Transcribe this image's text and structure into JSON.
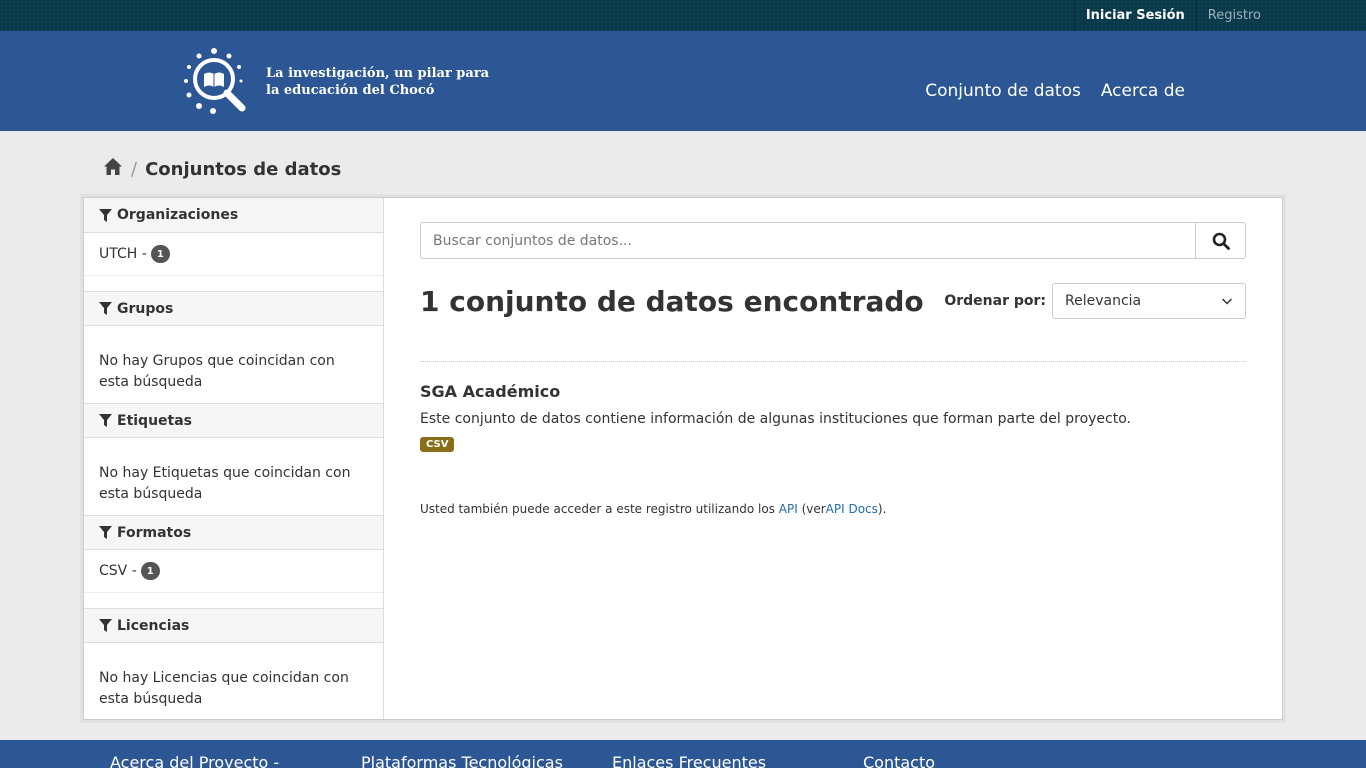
{
  "account": {
    "login": "Iniciar Sesión",
    "register": "Registro"
  },
  "masthead": {
    "logo_line1": "La investigación, un pilar para",
    "logo_line2": "la educación del Chocó",
    "nav": [
      "Conjunto de datos",
      "Acerca de"
    ]
  },
  "breadcrumb": {
    "current": "Conjuntos de datos"
  },
  "facets": {
    "organizations": {
      "title": "Organizaciones",
      "item": "UTCH -",
      "count": "1"
    },
    "groups": {
      "title": "Grupos",
      "empty": "No hay Grupos que coincidan con esta búsqueda"
    },
    "tags": {
      "title": "Etiquetas",
      "empty": "No hay Etiquetas que coincidan con esta búsqueda"
    },
    "formats": {
      "title": "Formatos",
      "item": "CSV -",
      "count": "1"
    },
    "licenses": {
      "title": "Licencias",
      "empty": "No hay Licencias que coincidan con esta búsqueda"
    }
  },
  "search": {
    "placeholder": "Buscar conjuntos de datos..."
  },
  "results": {
    "count_text": "1 conjunto de datos encontrado",
    "sort_label": "Ordenar por:",
    "sort_value": "Relevancia"
  },
  "dataset": {
    "title": "SGA Académico",
    "notes": "Este conjunto de datos contiene información de algunas instituciones que forman parte del proyecto.",
    "format": "CSV"
  },
  "api_note": {
    "prefix": "Usted también puede acceder a este registro utilizando los",
    "api": "API",
    "middle": "(ver",
    "docs": "API Docs",
    "suffix": ")."
  },
  "footer": {
    "columns": [
      "Acerca del Proyecto -",
      "Plataformas Tecnológicas",
      "Enlaces Frecuentes",
      "Contacto"
    ]
  },
  "colors": {
    "account_bar": "#093a4b",
    "masthead": "#2d5694",
    "format_badge": "#8a6d1a",
    "link": "#1f6bb5"
  }
}
